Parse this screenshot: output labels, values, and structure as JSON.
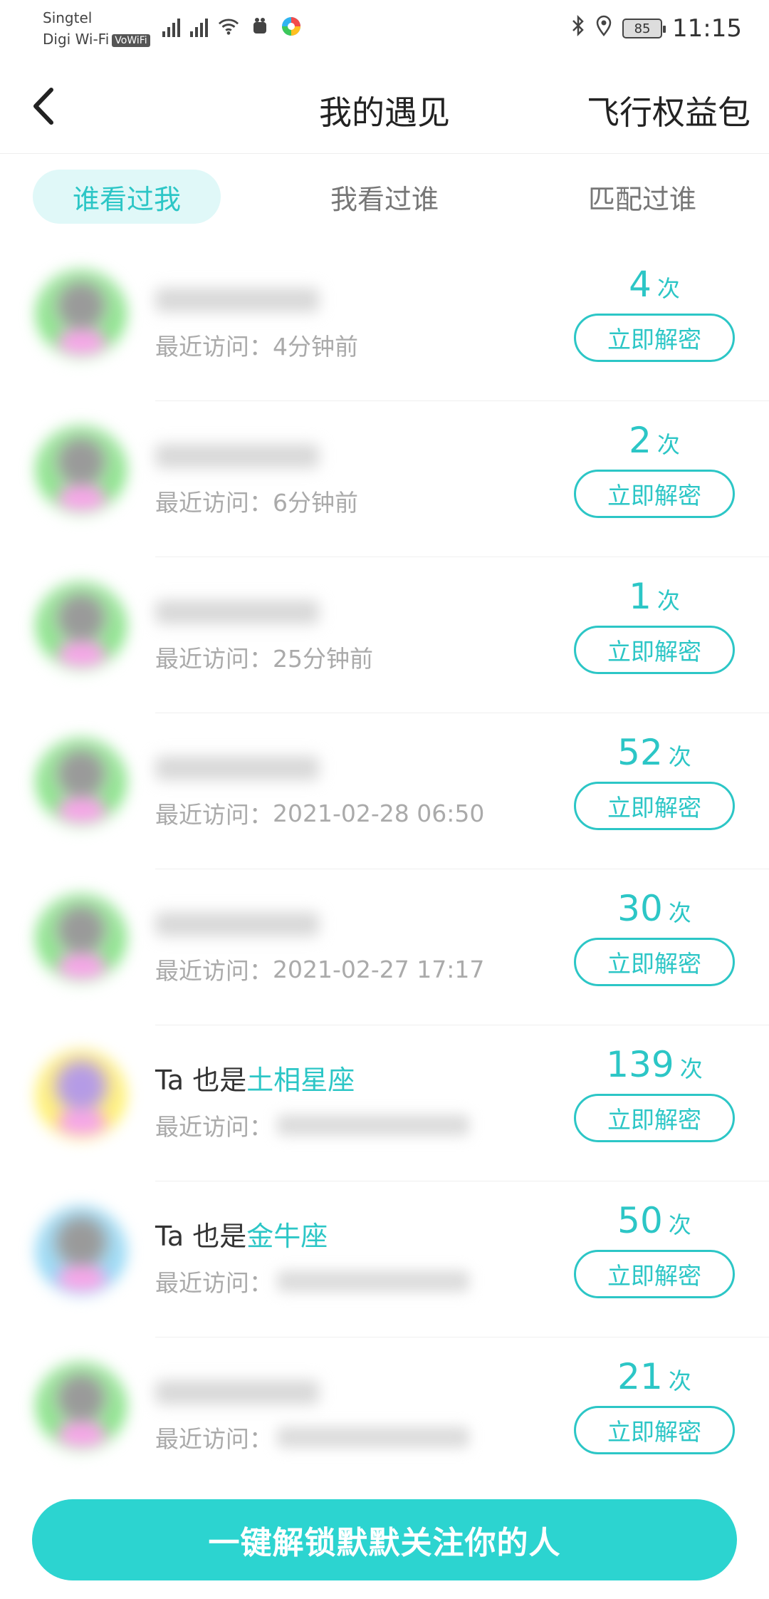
{
  "status_bar": {
    "carrier_line1": "Singtel",
    "carrier_line2": "Digi Wi-Fi",
    "vowifi": "VoWiFi",
    "battery": "85",
    "time": "11:15"
  },
  "nav": {
    "title": "我的遇见",
    "right_action": "飞行权益包"
  },
  "tabs": [
    {
      "label": "谁看过我",
      "active": true
    },
    {
      "label": "我看过谁",
      "active": false
    },
    {
      "label": "匹配过谁",
      "active": false
    }
  ],
  "visitors": [
    {
      "visit_label": "最近访问：",
      "visit_time": "4分钟前",
      "count": "4",
      "unit": "次",
      "button": "立即解密",
      "avatar": "green"
    },
    {
      "visit_label": "最近访问：",
      "visit_time": "6分钟前",
      "count": "2",
      "unit": "次",
      "button": "立即解密",
      "avatar": "green"
    },
    {
      "visit_label": "最近访问：",
      "visit_time": "25分钟前",
      "count": "1",
      "unit": "次",
      "button": "立即解密",
      "avatar": "green"
    },
    {
      "visit_label": "最近访问：",
      "visit_time": "2021-02-28 06:50",
      "count": "52",
      "unit": "次",
      "button": "立即解密",
      "avatar": "green"
    },
    {
      "visit_label": "最近访问：",
      "visit_time": "2021-02-27 17:17",
      "count": "30",
      "unit": "次",
      "button": "立即解密",
      "avatar": "green"
    },
    {
      "name_prefix": "Ta 也是",
      "name_highlight": "土相星座",
      "visit_label": "最近访问：",
      "count": "139",
      "unit": "次",
      "button": "立即解密",
      "avatar": "yellow"
    },
    {
      "name_prefix": "Ta 也是",
      "name_highlight": "金牛座",
      "visit_label": "最近访问：",
      "count": "50",
      "unit": "次",
      "button": "立即解密",
      "avatar": "blue"
    },
    {
      "visit_label": "最近访问：",
      "count": "21",
      "unit": "次",
      "button": "立即解密",
      "avatar": "green"
    }
  ],
  "bottom_button": "一键解锁默默关注你的人",
  "colors": {
    "accent": "#2cc6c6",
    "bottom_button": "#2cd4d0",
    "tab_active_bg": "#e0f8f8"
  }
}
